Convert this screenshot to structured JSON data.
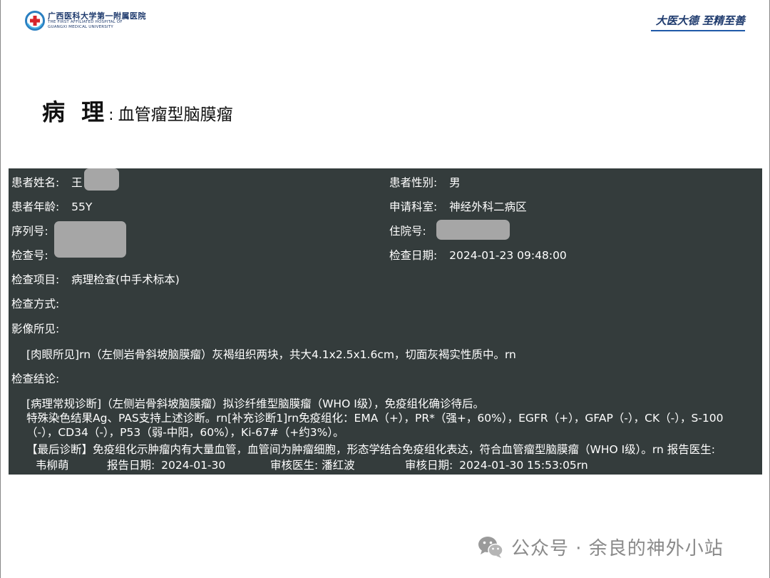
{
  "header": {
    "hospital_cn": "广西医科大学第一附属医院",
    "hospital_en_1": "THE FIRST AFFILIATED HOSPITAL OF",
    "hospital_en_2": "GUANGXI MEDICAL UNIVERSITY",
    "motto": "大医大德 至精至善"
  },
  "title": {
    "main": "病 理",
    "separator": ":",
    "sub": "血管瘤型脑膜瘤"
  },
  "report": {
    "patient_name_label": "患者姓名:",
    "patient_name_value": "王",
    "gender_label": "患者性别:",
    "gender_value": "男",
    "age_label": "患者年龄:",
    "age_value": "55Y",
    "dept_label": "申请科室:",
    "dept_value": "神经外科二病区",
    "serial_label": "序列号:",
    "inpatient_label": "住院号:",
    "exam_no_label": "检查号:",
    "exam_date_label": "检查日期:",
    "exam_date_value": "2024-01-23 09:48:00",
    "exam_item_label": "检查项目:",
    "exam_item_value": "病理检查(中手术标本)",
    "exam_method_label": "检查方式:",
    "imaging_label": "影像所见:",
    "imaging_text": "[肉眼所见]rn（左侧岩骨斜坡脑膜瘤）灰褐组织两块，共大4.1x2.5x1.6cm，切面灰褐实性质中。rn",
    "conclusion_label": "检查结论:",
    "conclusion_line1": "[病理常规诊断]（左侧岩骨斜坡脑膜瘤）拟诊纤维型脑膜瘤（WHO Ⅰ级），免疫组化确诊待后。",
    "conclusion_line2": "特殊染色结果Ag、PAS支持上述诊断。rn[补充诊断1]rn免疫组化：EMA（+），PR*（强+，60%），EGFR（+），GFAP（-），CK（-），S-100（-），CD34（-），P53（弱-中阳，60%），Ki-67#（+约3%）。",
    "conclusion_line3": "【最后诊断】免疫组化示肿瘤内有大量血管，血管间为肿瘤细胞，形态学结合免疫组化表达，符合血管瘤型脑膜瘤（WHO Ⅰ级）。rn 报告医生:",
    "reporter_name": "韦柳萌",
    "report_date_label": "报告日期:",
    "report_date_value": "2024-01-30",
    "reviewer_label": "审核医生:",
    "reviewer_value": "潘红波",
    "review_date_label": "审核日期:",
    "review_date_value": "2024-01-30 15:53:05rn"
  },
  "watermark": {
    "text": "公众号 · 余良的神外小站"
  },
  "colors": {
    "panel_bg": "#343c3c",
    "brand_blue": "#1f3b6e",
    "mask_gray": "#a6a6a6"
  }
}
